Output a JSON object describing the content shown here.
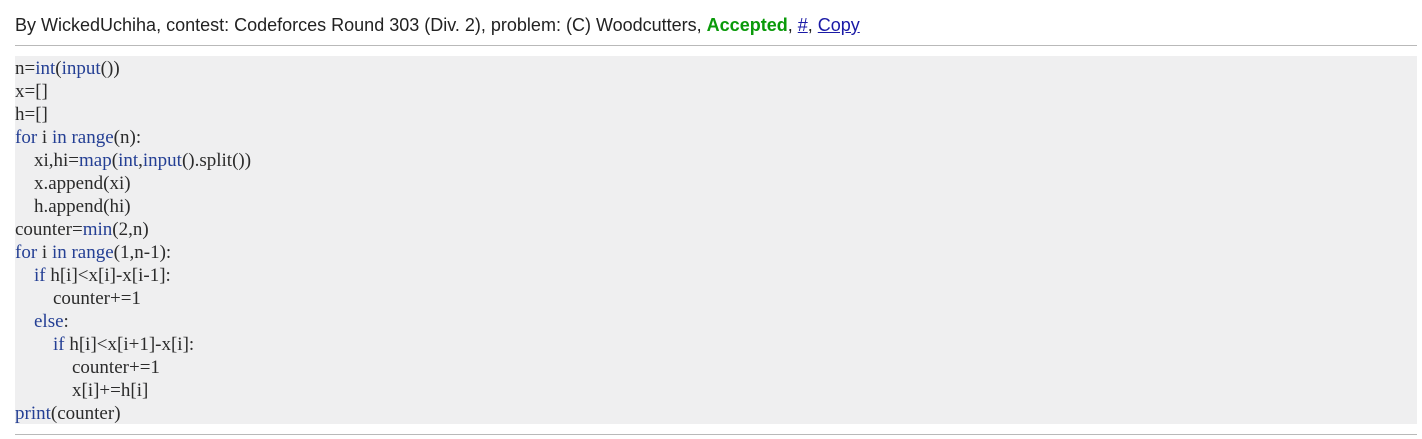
{
  "submission": {
    "by_prefix": "By ",
    "author": "WickedUchiha",
    "contest_prefix": ", contest: ",
    "contest": "Codeforces Round 303 (Div. 2)",
    "problem_prefix": ", problem: ",
    "problem": "(C) Woodcutters",
    "verdict_sep": ", ",
    "verdict": "Accepted",
    "link_sep_1": ", ",
    "hash_link": "#",
    "link_sep_2": ", ",
    "copy_link": "Copy"
  },
  "colors": {
    "verdict_accepted": "#0a9a0a",
    "link": "#1a1aa6",
    "code_background": "#efeff0",
    "keyword": "#243f94"
  },
  "code": {
    "language": "python",
    "lines": [
      "n=int(input())",
      "x=[]",
      "h=[]",
      "for i in range(n):",
      "    xi,hi=map(int,input().split())",
      "    x.append(xi)",
      "    h.append(hi)",
      "counter=min(2,n)",
      "for i in range(1,n-1):",
      "    if h[i]<x[i]-x[i-1]:",
      "        counter+=1",
      "    else:",
      "        if h[i]<x[i+1]-x[i]:",
      "            counter+=1",
      "            x[i]+=h[i]",
      "print(counter)"
    ]
  }
}
